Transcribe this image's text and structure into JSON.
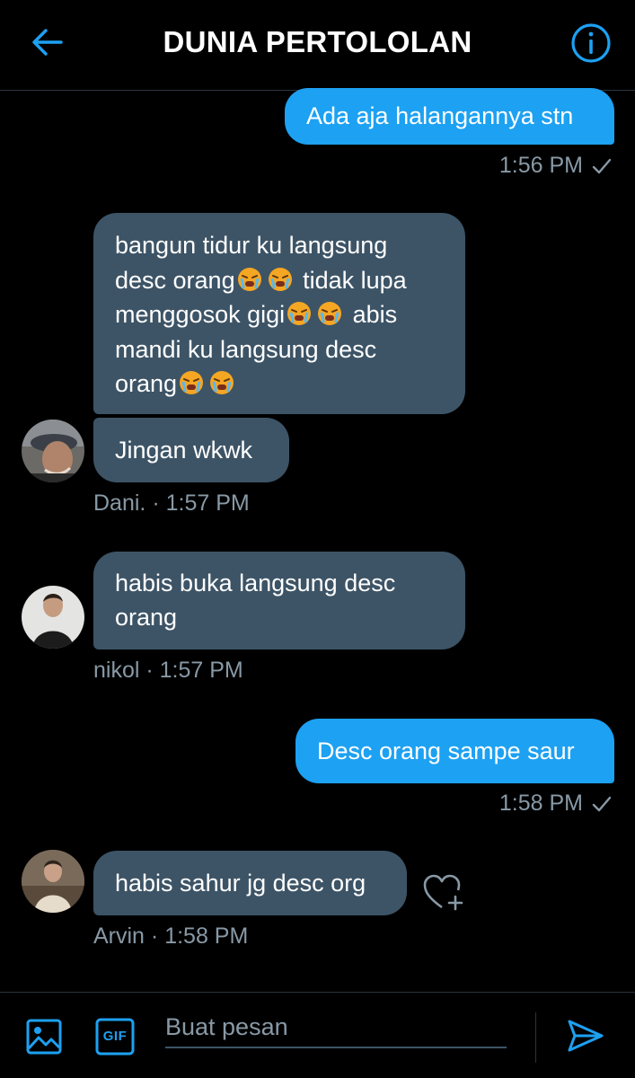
{
  "header": {
    "title": "DUNIA PERTOLOLAN",
    "back_icon": "arrow-left-icon",
    "info_icon": "info-icon"
  },
  "messages": [
    {
      "direction": "out",
      "text": "Ada aja halangannya stn",
      "time": "1:56 PM",
      "status_icon": "check-icon"
    },
    {
      "direction": "in",
      "lines": [
        "bangun tidur ku langsung",
        "desc orang",
        "tidak lupa",
        "menggosok gigi",
        "abis",
        "mandi ku langsung desc",
        "orang"
      ],
      "emoji": "crying-face-emoji"
    },
    {
      "direction": "in",
      "text": "Jingan wkwk",
      "sender": "Dani.",
      "separator": "·",
      "time": "1:57 PM"
    },
    {
      "direction": "in",
      "lines": [
        "habis buka langsung desc",
        "orang"
      ],
      "sender": "nikol",
      "separator": "·",
      "time": "1:57 PM"
    },
    {
      "direction": "out",
      "text": "Desc orang sampe saur",
      "time": "1:58 PM",
      "status_icon": "check-icon"
    },
    {
      "direction": "in",
      "text": "habis sahur jg desc org",
      "sender": "Arvin",
      "separator": "·",
      "time": "1:58 PM",
      "reaction_icon": "heart-plus-icon"
    }
  ],
  "composer": {
    "placeholder": "Buat pesan",
    "value": "",
    "image_icon": "image-icon",
    "gif_label": "GIF",
    "send_icon": "send-icon"
  },
  "colors": {
    "background": "#000000",
    "accent": "#1da1f2",
    "incoming_bubble": "#3d5466",
    "meta_text": "#8899a6",
    "divider": "#2a3440"
  }
}
